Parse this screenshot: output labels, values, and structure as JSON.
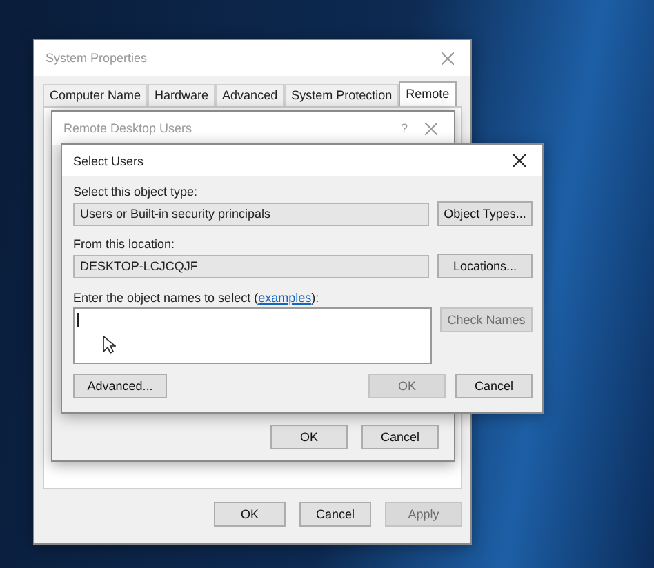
{
  "system_properties": {
    "title": "System Properties",
    "active": false,
    "tabs": [
      {
        "label": "Computer Name",
        "selected": false
      },
      {
        "label": "Hardware",
        "selected": false
      },
      {
        "label": "Advanced",
        "selected": false
      },
      {
        "label": "System Protection",
        "selected": false
      },
      {
        "label": "Remote",
        "selected": true
      }
    ],
    "buttons": [
      {
        "label": "OK",
        "disabled": false
      },
      {
        "label": "Cancel",
        "disabled": false
      },
      {
        "label": "Apply",
        "disabled": true
      }
    ]
  },
  "remote_desktop_users": {
    "title": "Remote Desktop Users",
    "active": false,
    "help": "?",
    "buttons": [
      {
        "label": "OK",
        "disabled": false
      },
      {
        "label": "Cancel",
        "disabled": false
      }
    ]
  },
  "select_users": {
    "title": "Select Users",
    "active": true,
    "object_type_label": "Select this object type:",
    "object_type": "Users or Built-in security principals",
    "object_types_button": {
      "label": "Object Types...",
      "disabled": false
    },
    "location_label": "From this location:",
    "location": "DESKTOP-LCJCQJF",
    "locations_button": {
      "label": "Locations...",
      "disabled": false
    },
    "names_label": {
      "before": "Enter the object names to select (",
      "link": "examples",
      "after": "):"
    },
    "check_names_button": {
      "label": "Check Names",
      "disabled": true
    },
    "advanced_button": {
      "label": "Advanced...",
      "disabled": false
    },
    "buttons": [
      {
        "label": "OK",
        "disabled": true
      },
      {
        "label": "Cancel",
        "disabled": false
      }
    ]
  }
}
